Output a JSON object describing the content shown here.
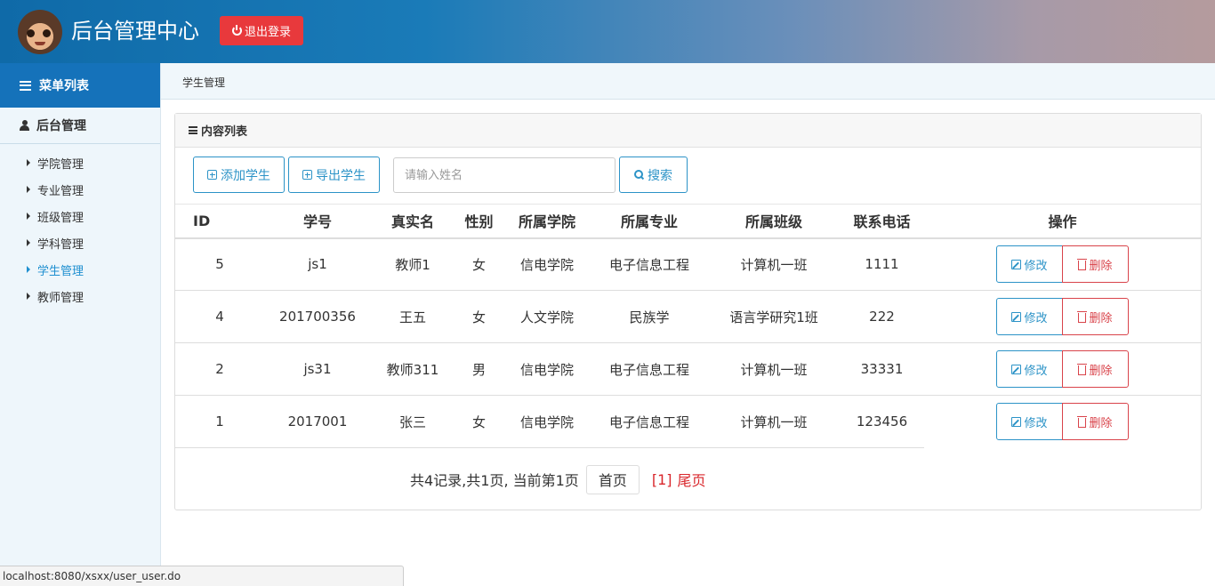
{
  "header": {
    "title": "后台管理中心",
    "logout_label": "退出登录"
  },
  "sidebar": {
    "menu_title": "菜单列表",
    "section_title": "后台管理",
    "items": [
      {
        "label": "学院管理"
      },
      {
        "label": "专业管理"
      },
      {
        "label": "班级管理"
      },
      {
        "label": "学科管理"
      },
      {
        "label": "学生管理",
        "active": true
      },
      {
        "label": "教师管理"
      }
    ]
  },
  "breadcrumb": "学生管理",
  "panel": {
    "title": "内容列表",
    "add_label": "添加学生",
    "export_label": "导出学生",
    "search_placeholder": "请输入姓名",
    "search_value": "",
    "search_label": "搜索"
  },
  "table": {
    "headers": [
      "ID",
      "学号",
      "真实名",
      "性别",
      "所属学院",
      "所属专业",
      "所属班级",
      "联系电话",
      "操作"
    ],
    "edit_label": "修改",
    "delete_label": "删除",
    "rows": [
      [
        "5",
        "js1",
        "教师1",
        "女",
        "信电学院",
        "电子信息工程",
        "计算机一班",
        "1111"
      ],
      [
        "4",
        "201700356",
        "王五",
        "女",
        "人文学院",
        "民族学",
        "语言学研究1班",
        "222"
      ],
      [
        "2",
        "js31",
        "教师311",
        "男",
        "信电学院",
        "电子信息工程",
        "计算机一班",
        "33331"
      ],
      [
        "1",
        "2017001",
        "张三",
        "女",
        "信电学院",
        "电子信息工程",
        "计算机一班",
        "123456"
      ]
    ]
  },
  "pager": {
    "summary": "共4记录,共1页, 当前第1页",
    "first_label": "首页",
    "current": "[1]",
    "last_label": "尾页"
  },
  "status_url": "localhost:8080/xsxx/user_user.do",
  "colors": {
    "primary": "#2c93c7",
    "danger": "#d9434a",
    "logout": "#e8393c",
    "sidebar_head": "#1572ba"
  }
}
